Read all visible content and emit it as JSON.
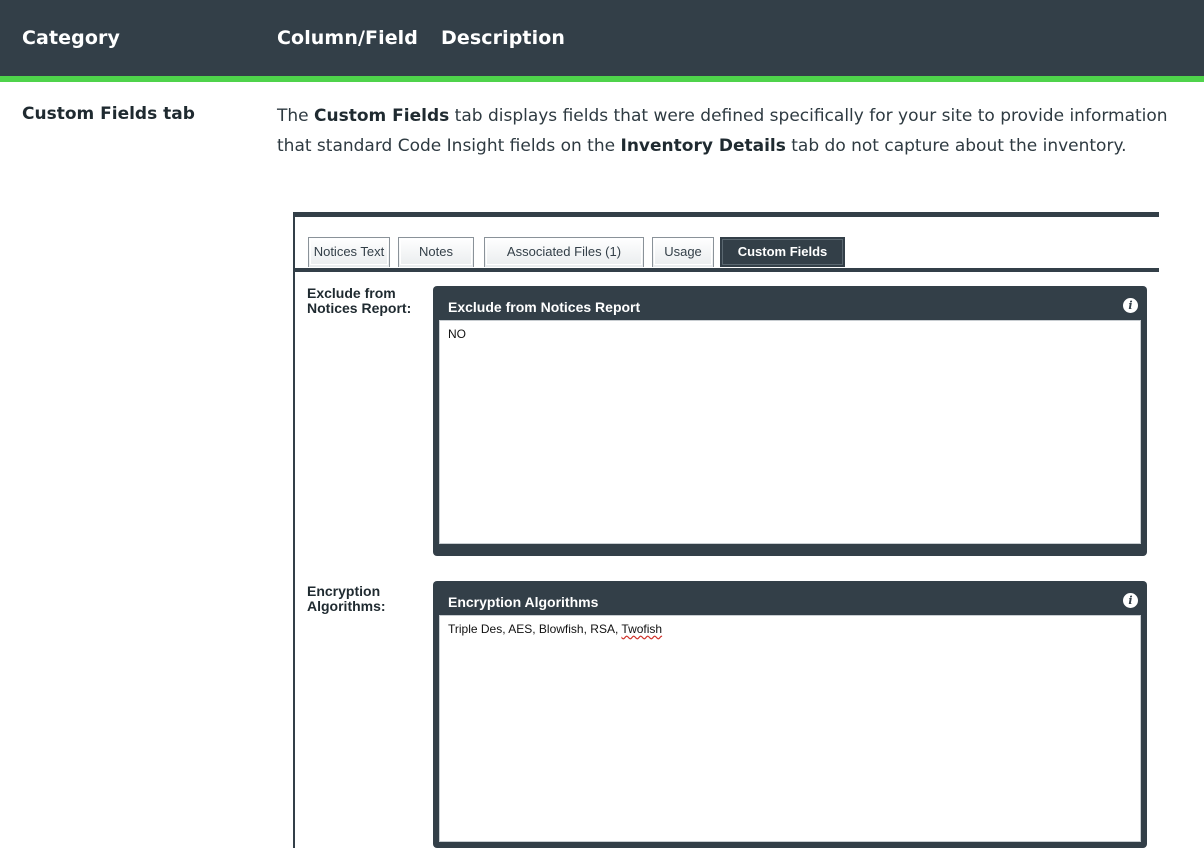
{
  "table": {
    "headers": {
      "category": "Category",
      "column": "Column/Field",
      "description": "Description"
    },
    "row": {
      "category": "Custom Fields tab",
      "description_parts": {
        "p1": "The ",
        "b1": "Custom Fields",
        "p2": " tab displays fields that were defined specifically for your site to provide information that standard Code Insight fields on the ",
        "b2": "Inventory Details",
        "p3": " tab do not capture about the inventory."
      }
    },
    "colors": {
      "header_bg": "#333f48",
      "accent": "#4fd34b"
    }
  },
  "screenshot": {
    "tabs": [
      {
        "label": "Notices Text",
        "active": false
      },
      {
        "label": "Notes",
        "active": false
      },
      {
        "label": "Associated Files (1)",
        "active": false
      },
      {
        "label": "Usage",
        "active": false
      },
      {
        "label": "Custom Fields",
        "active": true
      }
    ],
    "fields": [
      {
        "label": "Exclude from Notices Report:",
        "panel_title": "Exclude from Notices Report",
        "value": "NO"
      },
      {
        "label": "Encryption Algorithms:",
        "panel_title": "Encryption Algorithms",
        "value_main": "Triple Des, AES, Blowfish, RSA, ",
        "value_misspelled": "Twofish"
      }
    ],
    "icons": {
      "info": "info-icon"
    }
  }
}
